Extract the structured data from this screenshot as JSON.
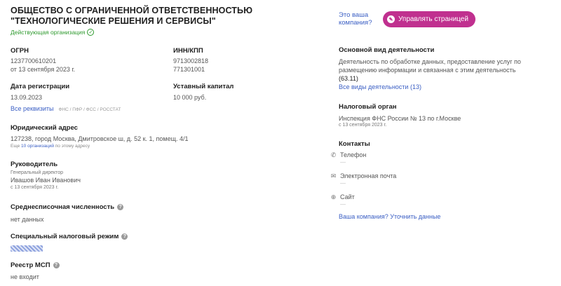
{
  "company": {
    "title": "ОБЩЕСТВО С ОГРАНИЧЕННОЙ ОТВЕТСТВЕННОСТЬЮ \"ТЕХНОЛОГИЧЕСКИЕ РЕШЕНИЯ И СЕРВИСЫ\"",
    "status": "Действующая организация"
  },
  "ogrn": {
    "label": "ОГРН",
    "value": "1237700610201",
    "date": "от 13 сентября 2023 г."
  },
  "inn": {
    "label": "ИНН/КПП",
    "inn": "9713002818",
    "kpp": "771301001"
  },
  "registration": {
    "label": "Дата регистрации",
    "value": "13.09.2023"
  },
  "capital": {
    "label": "Уставный капитал",
    "value": "10 000 руб."
  },
  "requisites": {
    "link": "Все реквизиты",
    "sources": "ФНС / ПФР / ФСС / РОССТАТ"
  },
  "address": {
    "label": "Юридический адрес",
    "value": "127238, город Москва, Дмитровское ш, д. 52 к. 1, помещ. 4/1",
    "note_prefix": "Еще",
    "note_link": "10 организаций",
    "note_suffix": "по этому адресу"
  },
  "head": {
    "label": "Руководитель",
    "role": "Генеральный директор",
    "name": "Ивашов Иван Иванович",
    "date": "с 13 сентября 2023 г."
  },
  "employees": {
    "label": "Среднесписочная численность",
    "value": "нет данных"
  },
  "tax_regime": {
    "label": "Специальный налоговый режим"
  },
  "msp": {
    "label": "Реестр МСП",
    "value": "не входит"
  },
  "claim": {
    "question": "Это ваша компания?",
    "button": "Управлять страницей"
  },
  "activity": {
    "label": "Основной вид деятельности",
    "value": "Деятельность по обработке данных, предоставление услуг по размещению информации и связанная с этим деятельность",
    "code": "(63.11)",
    "link": "Все виды деятельности (13)"
  },
  "tax_authority": {
    "label": "Налоговый орган",
    "value": "Инспекция ФНС России № 13 по г.Москве",
    "date": "с 13 сентября 2023 г."
  },
  "contacts": {
    "label": "Контакты",
    "items": [
      {
        "label": "Телефон",
        "value": "—",
        "icon": "phone-icon"
      },
      {
        "label": "Электронная почта",
        "value": "—",
        "icon": "mail-icon"
      },
      {
        "label": "Сайт",
        "value": "—",
        "icon": "globe-icon"
      }
    ],
    "correct_link": "Ваша компания? Уточнить данные"
  }
}
